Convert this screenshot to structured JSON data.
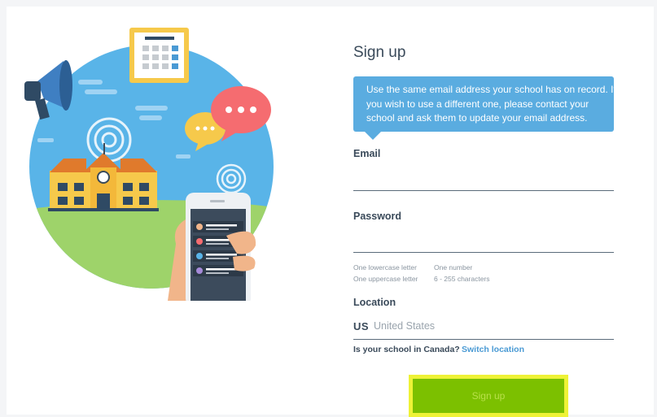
{
  "signup": {
    "title": "Sign up",
    "notice": "Use the same email address your school has on record. If you wish to use a different one, please contact your school and ask them to update your email address.",
    "email_label": "Email",
    "email_value": "",
    "password_label": "Password",
    "password_value": "",
    "password_rules": [
      "One lowercase letter",
      "One number",
      "One uppercase letter",
      "6 - 255 characters"
    ],
    "location_label": "Location",
    "location_code": "US",
    "location_name": "United States",
    "canada_question": "Is your school in Canada?",
    "switch_location": "Switch location",
    "submit_label": "Sign up"
  },
  "colors": {
    "accent_blue": "#5aace0",
    "button_green": "#7cc000",
    "highlight_yellow": "#eef236",
    "link_blue": "#4a9ad4"
  },
  "icons": [
    "megaphone-icon",
    "calendar-icon",
    "chat-bubble-icon",
    "school-building-icon",
    "signal-icon",
    "phone-icon"
  ]
}
